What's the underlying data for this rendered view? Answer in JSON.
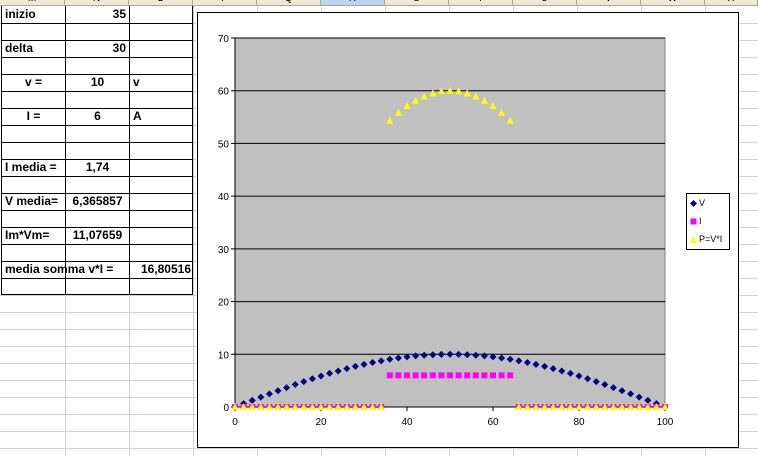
{
  "column_headers": [
    "M",
    "N",
    "O",
    "P",
    "Q",
    "R",
    "S",
    "T",
    "U",
    "V",
    "W",
    "X"
  ],
  "table": {
    "inizio_label": "inizio",
    "inizio_value": "35",
    "delta_label": "delta",
    "delta_value": "30",
    "v_label": "v  =",
    "v_value": "10",
    "v_unit": "v",
    "i_label": "I  =",
    "i_value": "6",
    "i_unit": "A",
    "i_media_label": "I media =",
    "i_media_value": "1,74",
    "v_media_label": "V media=",
    "v_media_value": "6,365857",
    "imvm_label": "Im*Vm=",
    "imvm_value": "11,07659",
    "media_somma_label": "media somma v*I  =",
    "media_somma_value": "16,80516"
  },
  "chart_data": {
    "type": "scatter",
    "title": "",
    "xlabel": "",
    "ylabel": "",
    "xlim": [
      0,
      100
    ],
    "ylim": [
      0,
      70
    ],
    "x_ticks": [
      "0",
      "20",
      "40",
      "60",
      "80",
      "100"
    ],
    "y_ticks": [
      "0",
      "10",
      "20",
      "30",
      "40",
      "50",
      "60",
      "70"
    ],
    "plot_background": "#c0c0c0",
    "grid": "horizontal",
    "legend_position": "right",
    "x": [
      0,
      2,
      4,
      6,
      8,
      10,
      12,
      14,
      16,
      18,
      20,
      22,
      24,
      26,
      28,
      30,
      32,
      34,
      36,
      38,
      40,
      42,
      44,
      46,
      48,
      50,
      52,
      54,
      56,
      58,
      60,
      62,
      64,
      66,
      68,
      70,
      72,
      74,
      76,
      78,
      80,
      82,
      84,
      86,
      88,
      90,
      92,
      94,
      96,
      98,
      100
    ],
    "series": [
      {
        "name": "V",
        "color": "#000080",
        "marker": "diamond",
        "values": [
          0,
          0.63,
          1.25,
          1.87,
          2.49,
          3.09,
          3.68,
          4.26,
          4.82,
          5.36,
          5.88,
          6.37,
          6.84,
          7.29,
          7.71,
          8.09,
          8.44,
          8.76,
          9.05,
          9.29,
          9.51,
          9.69,
          9.82,
          9.92,
          9.98,
          10,
          9.98,
          9.92,
          9.82,
          9.69,
          9.51,
          9.29,
          9.05,
          8.76,
          8.44,
          8.09,
          7.71,
          7.29,
          6.84,
          6.37,
          5.88,
          5.36,
          4.82,
          4.26,
          3.68,
          3.09,
          2.49,
          1.87,
          1.25,
          0.63,
          0
        ]
      },
      {
        "name": "I",
        "color": "#ff00ff",
        "marker": "square",
        "values": [
          0,
          0,
          0,
          0,
          0,
          0,
          0,
          0,
          0,
          0,
          0,
          0,
          0,
          0,
          0,
          0,
          0,
          0,
          6,
          6,
          6,
          6,
          6,
          6,
          6,
          6,
          6,
          6,
          6,
          6,
          6,
          6,
          6,
          0,
          0,
          0,
          0,
          0,
          0,
          0,
          0,
          0,
          0,
          0,
          0,
          0,
          0,
          0,
          0,
          0,
          0
        ]
      },
      {
        "name": "P=V*I",
        "color": "#ffff00",
        "marker": "triangle",
        "values": [
          0,
          0,
          0,
          0,
          0,
          0,
          0,
          0,
          0,
          0,
          0,
          0,
          0,
          0,
          0,
          0,
          0,
          0,
          54.3,
          55.8,
          57.1,
          58.1,
          58.9,
          59.5,
          59.9,
          60,
          59.9,
          59.5,
          58.9,
          58.1,
          57.1,
          55.8,
          54.3,
          0,
          0,
          0,
          0,
          0,
          0,
          0,
          0,
          0,
          0,
          0,
          0,
          0,
          0,
          0,
          0,
          0,
          0
        ]
      }
    ]
  }
}
